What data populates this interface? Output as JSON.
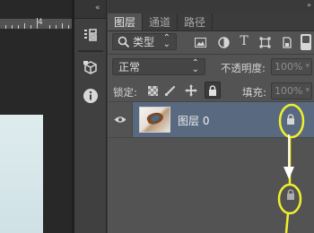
{
  "canvas": {
    "ruler_number": "4"
  },
  "toolbar": {
    "collapse": "«",
    "history_icon": "history-icon",
    "cube_icon": "3d-cube-icon",
    "info_icon": "info-icon"
  },
  "panel": {
    "collapse": "»",
    "tabs": [
      {
        "label": "图层",
        "active": true
      },
      {
        "label": "通道",
        "active": false
      },
      {
        "label": "路径",
        "active": false
      }
    ],
    "filter": {
      "kind_label": "类型",
      "filter_icons": [
        "image-filter-icon",
        "adjustment-filter-icon",
        "type-filter-icon",
        "shape-filter-icon",
        "smart-object-filter-icon"
      ]
    },
    "blend": {
      "mode": "正常",
      "opacity_label": "不透明度:",
      "opacity_value": "100%"
    },
    "lock": {
      "label": "锁定:",
      "fill_label": "填充:",
      "fill_value": "100%"
    },
    "layer": {
      "name": "图层 0",
      "visible": true,
      "locked": true
    }
  },
  "annotation_color": "#f1ef2c"
}
